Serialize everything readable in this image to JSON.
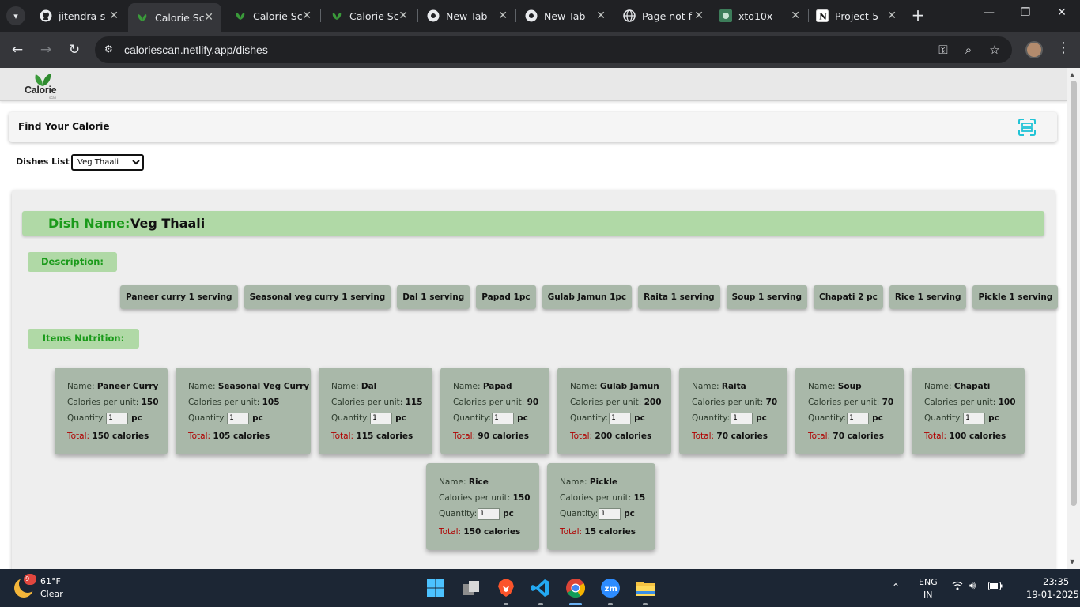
{
  "browser": {
    "tabs": [
      {
        "title": "jitendra-s",
        "icon": "github-icon"
      },
      {
        "title": "Calorie Sc",
        "icon": "calorie-leaf-icon",
        "active": true
      },
      {
        "title": "Calorie Sc",
        "icon": "calorie-leaf-icon"
      },
      {
        "title": "Calorie Sc",
        "icon": "calorie-leaf-icon"
      },
      {
        "title": "New Tab",
        "icon": "chrome-icon"
      },
      {
        "title": "New Tab",
        "icon": "chrome-icon"
      },
      {
        "title": "Page not f",
        "icon": "globe-icon"
      },
      {
        "title": "xto10x",
        "icon": "xto10x-icon"
      },
      {
        "title": "Project-5",
        "icon": "notion-icon"
      }
    ],
    "url": "caloriescan.netlify.app/dishes"
  },
  "site": {
    "logo_text": "Calorie",
    "logo_sub": "scan",
    "find_title": "Find Your Calorie",
    "dishes_label": "Dishes List",
    "selected_dish": "Veg Thaali",
    "dish_name_label": "Dish Name:",
    "dish_name_value": "Veg Thaali",
    "description_label": "Description:",
    "items_nutrition_label": "Items Nutrition:",
    "description_items": [
      "Paneer curry 1 serving",
      "Seasonal veg curry 1 serving",
      "Dal 1 serving",
      "Papad 1pc",
      "Gulab Jamun 1pc",
      "Raita 1 serving",
      "Soup 1 serving",
      "Chapati 2 pc",
      "Rice 1 serving",
      "Pickle 1 serving"
    ],
    "labels": {
      "name": "Name:",
      "cal_per_unit": "Calories per unit:",
      "quantity": "Quantity:",
      "unit": "pc",
      "total": "Total:",
      "calories_suffix": "calories"
    },
    "nutrition_items": [
      {
        "name": "Paneer Curry",
        "cal": "150",
        "qty": "1",
        "total": "150 calories"
      },
      {
        "name": "Seasonal Veg Curry",
        "cal": "105",
        "qty": "1",
        "total": "105 calories"
      },
      {
        "name": "Dal",
        "cal": "115",
        "qty": "1",
        "total": "115 calories"
      },
      {
        "name": "Papad",
        "cal": "90",
        "qty": "1",
        "total": "90 calories"
      },
      {
        "name": "Gulab Jamun",
        "cal": "200",
        "qty": "1",
        "total": "200 calories"
      },
      {
        "name": "Raita",
        "cal": "70",
        "qty": "1",
        "total": "70 calories"
      },
      {
        "name": "Soup",
        "cal": "70",
        "qty": "1",
        "total": "70 calories"
      },
      {
        "name": "Chapati",
        "cal": "100",
        "qty": "1",
        "total": "100 calories"
      },
      {
        "name": "Rice",
        "cal": "150",
        "qty": "1",
        "total": "150 calories"
      },
      {
        "name": "Pickle",
        "cal": "15",
        "qty": "1",
        "total": "15 calories"
      }
    ]
  },
  "taskbar": {
    "weather_temp": "61°F",
    "weather_cond": "Clear",
    "weather_badge": "9+",
    "lang_1": "ENG",
    "lang_2": "IN",
    "time": "23:35",
    "date": "19-01-2025"
  },
  "colors": {
    "accent_green": "#1a9a1a",
    "pill_green": "#b0d9a6",
    "card_sage": "#a9b8a9",
    "total_red": "#b00000",
    "scan_cyan": "#22c4d6"
  }
}
